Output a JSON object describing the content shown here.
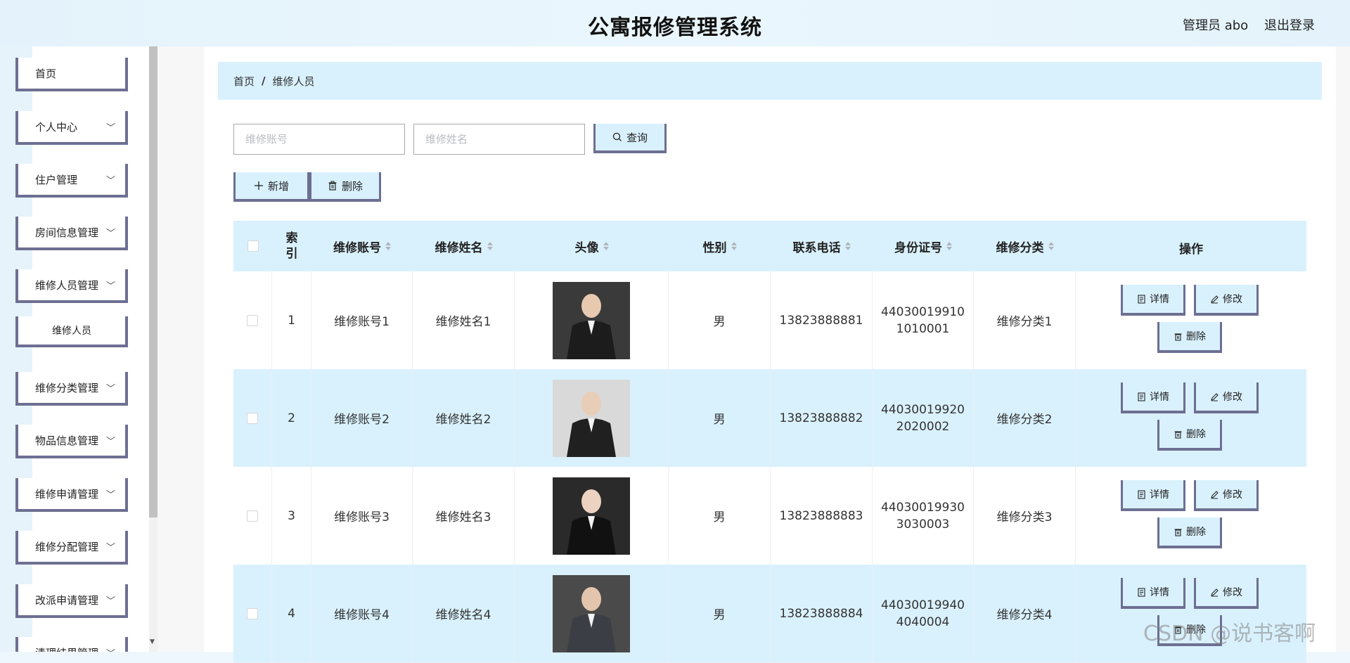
{
  "header": {
    "title": "公寓报修管理系统",
    "user": "管理员 abo",
    "logout": "退出登录"
  },
  "sidebar": {
    "items": [
      {
        "label": "首页",
        "chevron": false
      },
      {
        "label": "个人中心",
        "chevron": true
      },
      {
        "label": "住户管理",
        "chevron": true
      },
      {
        "label": "房间信息管理",
        "chevron": true
      },
      {
        "label": "维修人员管理",
        "chevron": true
      },
      {
        "label": "维修人员",
        "chevron": false,
        "sub": true
      },
      {
        "label": "维修分类管理",
        "chevron": true
      },
      {
        "label": "物品信息管理",
        "chevron": true
      },
      {
        "label": "维修申请管理",
        "chevron": true
      },
      {
        "label": "维修分配管理",
        "chevron": true
      },
      {
        "label": "改派申请管理",
        "chevron": true
      },
      {
        "label": "清理结果管理",
        "chevron": true
      }
    ]
  },
  "breadcrumb": {
    "home": "首页",
    "separator": "/",
    "current": "维修人员"
  },
  "search": {
    "account_placeholder": "维修账号",
    "name_placeholder": "维修姓名",
    "query_label": "查询"
  },
  "toolbar": {
    "add_label": "新增",
    "delete_label": "删除"
  },
  "table": {
    "headers": {
      "index_line1": "索",
      "index_line2": "引",
      "account": "维修账号",
      "name": "维修姓名",
      "avatar": "头像",
      "gender": "性别",
      "phone": "联系电话",
      "idcard": "身份证号",
      "category": "维修分类",
      "actions": "操作"
    },
    "rows": [
      {
        "index": "1",
        "account": "维修账号1",
        "name": "维修姓名1",
        "gender": "男",
        "phone": "13823888881",
        "idcard_line1": "44030019910",
        "idcard_line2": "1010001",
        "category": "维修分类1"
      },
      {
        "index": "2",
        "account": "维修账号2",
        "name": "维修姓名2",
        "gender": "男",
        "phone": "13823888882",
        "idcard_line1": "44030019920",
        "idcard_line2": "2020002",
        "category": "维修分类2"
      },
      {
        "index": "3",
        "account": "维修账号3",
        "name": "维修姓名3",
        "gender": "男",
        "phone": "13823888883",
        "idcard_line1": "44030019930",
        "idcard_line2": "3030003",
        "category": "维修分类3"
      },
      {
        "index": "4",
        "account": "维修账号4",
        "name": "维修姓名4",
        "gender": "男",
        "phone": "13823888884",
        "idcard_line1": "44030019940",
        "idcard_line2": "4040004",
        "category": "维修分类4"
      }
    ],
    "row_actions": {
      "detail": "详情",
      "edit": "修改",
      "delete": "删除"
    }
  },
  "watermark": "CSDN @说书客啊",
  "colors": {
    "accent": "#d9f1fd",
    "border": "#6d6f92",
    "header_bg": "#e4f3fb"
  }
}
